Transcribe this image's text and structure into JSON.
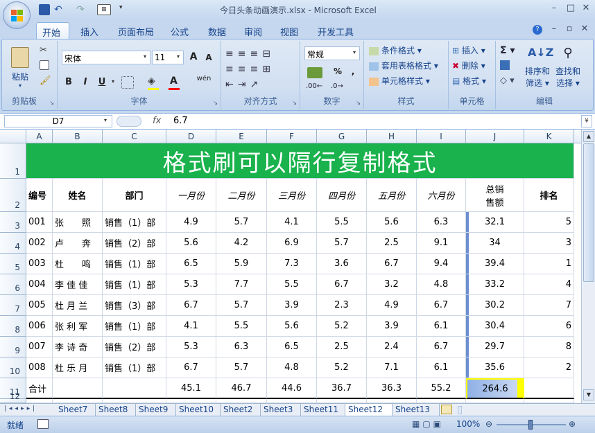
{
  "window": {
    "title": "今日头条动画演示.xlsx - Microsoft Excel"
  },
  "tabs": [
    "开始",
    "插入",
    "页面布局",
    "公式",
    "数据",
    "审阅",
    "视图",
    "开发工具"
  ],
  "ribbon": {
    "clipboard": {
      "paste": "粘贴",
      "label": "剪贴板"
    },
    "font": {
      "name": "宋体",
      "size": "11",
      "label": "字体",
      "bold": "B",
      "italic": "I",
      "underline": "U",
      "grow": "A",
      "shrink": "A",
      "phonetic": "wén"
    },
    "align": {
      "label": "对齐方式"
    },
    "number": {
      "format": "常规",
      "label": "数字",
      "percent": "%",
      "comma": ","
    },
    "styles": {
      "cond": "条件格式",
      "table": "套用表格格式",
      "cell": "单元格样式",
      "label": "样式"
    },
    "cells": {
      "insert": "插入",
      "delete": "删除",
      "format": "格式",
      "label": "单元格"
    },
    "editing": {
      "sort": "排序和",
      "sort2": "筛选",
      "find": "查找和",
      "find2": "选择",
      "label": "编辑"
    }
  },
  "formula_bar": {
    "name_box": "D7",
    "fx": "fx",
    "value": "6.7"
  },
  "columns": [
    "A",
    "B",
    "C",
    "D",
    "E",
    "F",
    "G",
    "H",
    "I",
    "J",
    "K"
  ],
  "rows": [
    "1",
    "2",
    "3",
    "4",
    "5",
    "6",
    "7",
    "8",
    "9",
    "10",
    "11",
    "12"
  ],
  "sheet": {
    "title": "格式刷可以隔行复制格式",
    "headers": [
      "编号",
      "姓名",
      "部门",
      "一月份",
      "二月份",
      "三月份",
      "四月份",
      "五月份",
      "六月份",
      "总销\n售额",
      "排名"
    ],
    "data": [
      [
        "001",
        "张　　照",
        "销售（1）部",
        "4.9",
        "5.7",
        "4.1",
        "5.5",
        "5.6",
        "6.3",
        "32.1",
        "5"
      ],
      [
        "002",
        "卢　　奔",
        "销售（2）部",
        "5.6",
        "4.2",
        "6.9",
        "5.7",
        "2.5",
        "9.1",
        "34",
        "3"
      ],
      [
        "003",
        "杜　　鸣",
        "销售（1）部",
        "6.5",
        "5.9",
        "7.3",
        "3.6",
        "6.7",
        "9.4",
        "39.4",
        "1"
      ],
      [
        "004",
        "李 佳 佳",
        "销售（1）部",
        "5.3",
        "7.7",
        "5.5",
        "6.7",
        "3.2",
        "4.8",
        "33.2",
        "4"
      ],
      [
        "005",
        "杜 月 兰",
        "销售（3）部",
        "6.7",
        "5.7",
        "3.9",
        "2.3",
        "4.9",
        "6.7",
        "30.2",
        "7"
      ],
      [
        "006",
        "张 利 军",
        "销售（1）部",
        "4.1",
        "5.5",
        "5.6",
        "5.2",
        "3.9",
        "6.1",
        "30.4",
        "6"
      ],
      [
        "007",
        "李 诗 奇",
        "销售（2）部",
        "5.3",
        "6.3",
        "6.5",
        "2.5",
        "2.4",
        "6.7",
        "29.7",
        "8"
      ],
      [
        "008",
        "杜 乐 月",
        "销售（1）部",
        "6.7",
        "5.7",
        "4.8",
        "5.2",
        "7.1",
        "6.1",
        "35.6",
        "2"
      ]
    ],
    "total": [
      "合计",
      "",
      "",
      "45.1",
      "46.7",
      "44.6",
      "36.7",
      "36.3",
      "55.2",
      "264.6",
      ""
    ]
  },
  "sheet_tabs": [
    "Sheet7",
    "Sheet8",
    "Sheet9",
    "Sheet10",
    "Sheet2",
    "Sheet3",
    "Sheet11",
    "Sheet12",
    "Sheet13"
  ],
  "active_sheet": "Sheet12",
  "status": {
    "ready": "就绪",
    "zoom": "100%"
  },
  "colors": {
    "banner": "#19b24c",
    "ribbon": "#d1dff1",
    "accent": "#15428b"
  }
}
